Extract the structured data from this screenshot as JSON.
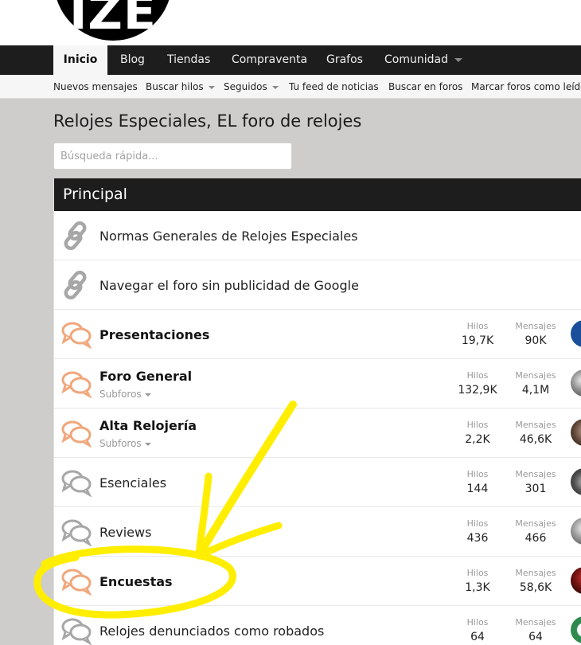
{
  "logo": {
    "text": "IZE"
  },
  "nav": {
    "tabs": [
      {
        "label": "Inicio",
        "active": true
      },
      {
        "label": "Blog"
      },
      {
        "label": "Tiendas"
      },
      {
        "label": "Compraventa"
      },
      {
        "label": "Grafos"
      },
      {
        "label": "Comunidad"
      }
    ]
  },
  "subnav": {
    "items": [
      {
        "label": "Nuevos mensajes"
      },
      {
        "label": "Buscar hilos"
      },
      {
        "label": "Seguidos"
      },
      {
        "label": "Tu feed de noticias"
      },
      {
        "label": "Buscar en foros"
      },
      {
        "label": "Marcar foros como leídos"
      }
    ]
  },
  "page": {
    "title": "Relojes Especiales, EL foro de relojes"
  },
  "search": {
    "placeholder": "Búsqueda rápida..."
  },
  "category": {
    "title": "Principal"
  },
  "labels": {
    "threads": "Hilos",
    "messages": "Mensajes",
    "subforums": "Subforos"
  },
  "forums": [
    {
      "title": "Normas Generales de Relojes Especiales",
      "type": "link"
    },
    {
      "title": "Navegar el foro sin publicidad de Google",
      "type": "link"
    },
    {
      "title": "Presentaciones",
      "type": "unread",
      "threads": "19,7K",
      "messages": "90K"
    },
    {
      "title": "Foro General",
      "type": "unread",
      "subforums": true,
      "threads": "132,9K",
      "messages": "4,1M"
    },
    {
      "title": "Alta Relojería",
      "type": "unread",
      "subforums": true,
      "threads": "2,2K",
      "messages": "46,6K"
    },
    {
      "title": "Esenciales",
      "type": "read",
      "threads": "144",
      "messages": "301"
    },
    {
      "title": "Reviews",
      "type": "read",
      "threads": "436",
      "messages": "466"
    },
    {
      "title": "Encuestas",
      "type": "unread",
      "threads": "1,3K",
      "messages": "58,6K"
    },
    {
      "title": "Relojes denunciados como robados",
      "type": "read",
      "threads": "64",
      "messages": "64"
    }
  ],
  "colors": {
    "unread_icon": "#f0a77c",
    "read_icon": "#a7a7a7",
    "nav_bg": "#1d1d1d",
    "annotation": "#ffee00"
  }
}
